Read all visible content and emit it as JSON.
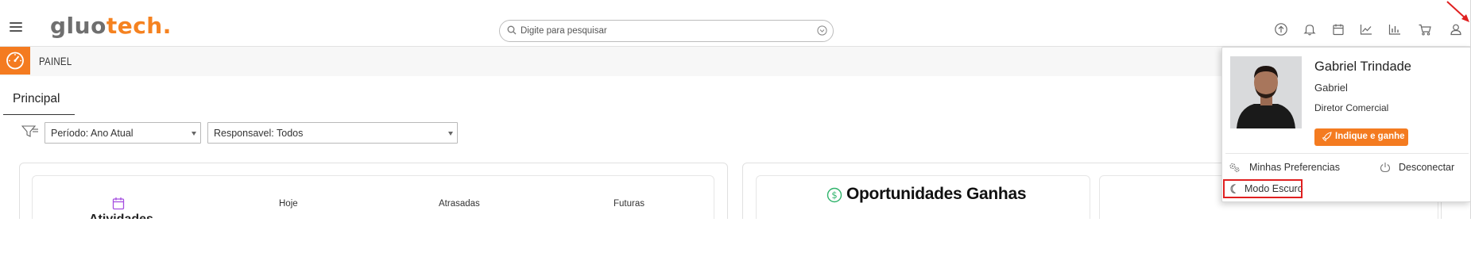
{
  "header": {
    "logo_part1": "gluo",
    "logo_part2": "tech.",
    "search_placeholder": "Digite para pesquisar"
  },
  "icons": {
    "topbar": [
      "upload-icon",
      "bell-icon",
      "calendar-icon",
      "line-chart-icon",
      "bar-chart-icon",
      "cart-icon",
      "user-icon"
    ]
  },
  "page": {
    "section_label": "PAINEL",
    "tab_label": "Principal"
  },
  "filters": {
    "periodo": "Período: Ano Atual",
    "responsavel": "Responsavel: Todos"
  },
  "activities": {
    "title": "Atividades",
    "col_hoje": "Hoje",
    "col_atrasadas": "Atrasadas",
    "col_futuras": "Futuras"
  },
  "opportunities": {
    "title": "Oportunidades Ganhas"
  },
  "user_menu": {
    "name": "Gabriel Trindade",
    "nickname": "Gabriel",
    "role": "Diretor Comercial",
    "referral_button": "Indique e ganhe",
    "preferences": "Minhas Preferencias",
    "logout": "Desconectar",
    "dark_mode": "Modo Escuro"
  },
  "colors": {
    "brand_orange": "#f47b20",
    "logo_gray": "#6f6f6f",
    "opportunity_green": "#2fb36b",
    "calendar_purple": "#a54ee0",
    "highlight_red": "#e02020"
  }
}
